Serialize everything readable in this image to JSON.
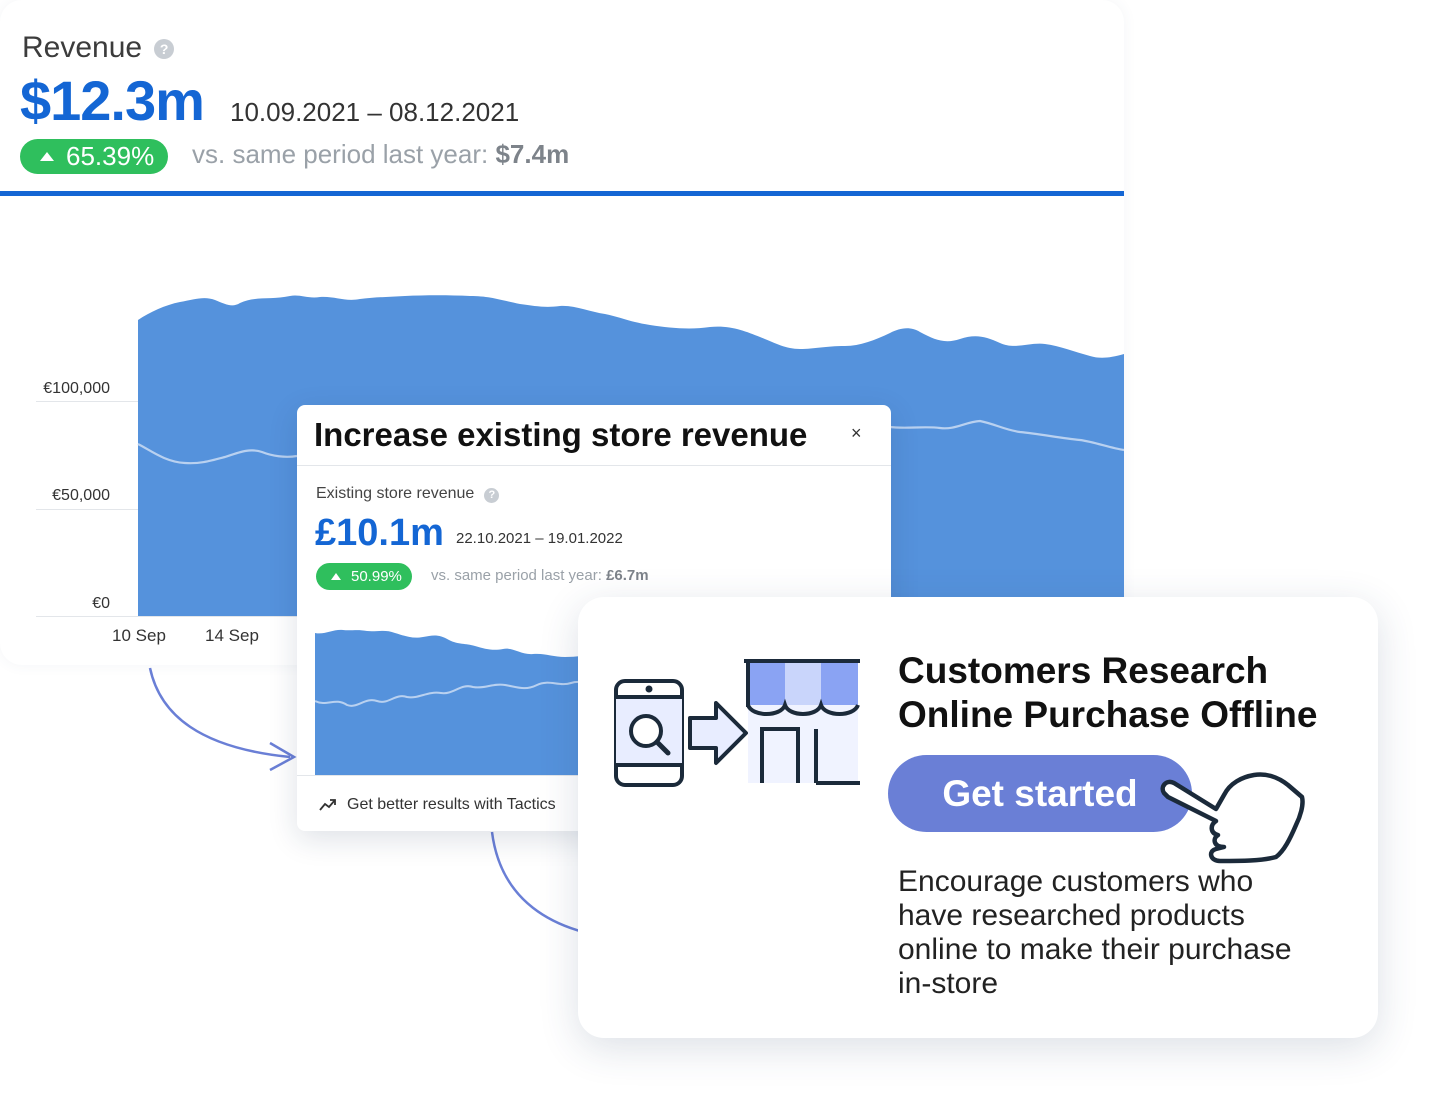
{
  "revenue_card": {
    "title": "Revenue",
    "value": "$12.3m",
    "date_range": "10.09.2021 – 08.12.2021",
    "change": "65.39%",
    "compare_label": "vs. same period last year:",
    "compare_value": "$7.4m",
    "y_labels": [
      "€100,000",
      "€50,000",
      "€0"
    ],
    "x_labels": [
      "10 Sep",
      "14 Sep"
    ],
    "accent_color": "#1466d4",
    "area_color": "#5592dc"
  },
  "store_card": {
    "title": "Increase existing store revenue",
    "close_icon": "×",
    "subtitle": "Existing store revenue",
    "value": "£10.1m",
    "date_range": "22.10.2021 – 19.01.2022",
    "change": "50.99%",
    "compare_label": "vs. same period last year:",
    "compare_value": "£6.7m",
    "footer_text": "Get better results with Tactics"
  },
  "promo_card": {
    "title": "Customers Research Online Purchase Offline",
    "button_label": "Get started",
    "description": "Encourage customers who have researched products online to make their purchase in-store",
    "button_color": "#6a7fd6"
  }
}
